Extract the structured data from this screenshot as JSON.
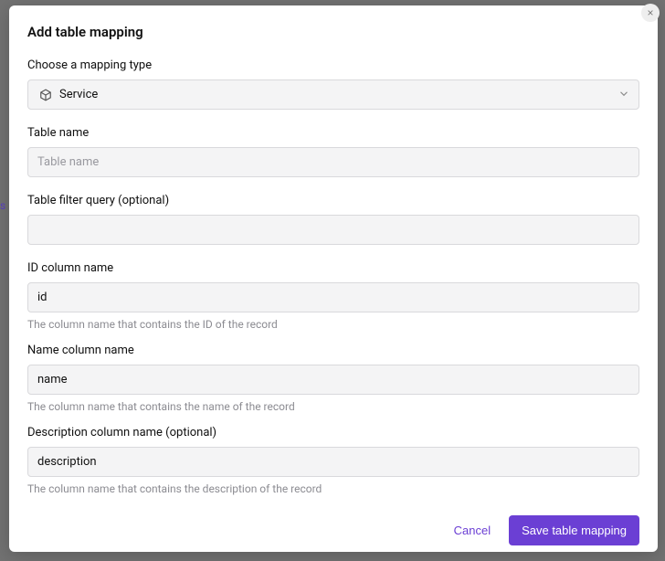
{
  "extleft_char": "s",
  "modal": {
    "title": "Add table mapping",
    "close_aria": "Close",
    "mapping_type": {
      "label": "Choose a mapping type",
      "value": "Service",
      "icon_name": "cube-icon"
    },
    "table_name": {
      "label": "Table name",
      "placeholder": "Table name",
      "value": ""
    },
    "table_filter": {
      "label": "Table filter query (optional)",
      "value": ""
    },
    "id_col": {
      "label": "ID column name",
      "value": "id",
      "hint": "The column name that contains the ID of the record"
    },
    "name_col": {
      "label": "Name column name",
      "value": "name",
      "hint": "The column name that contains the name of the record"
    },
    "desc_col": {
      "label": "Description column name (optional)",
      "value": "description",
      "hint": "The column name that contains the description of the record"
    },
    "footer": {
      "cancel": "Cancel",
      "save": "Save table mapping"
    }
  }
}
